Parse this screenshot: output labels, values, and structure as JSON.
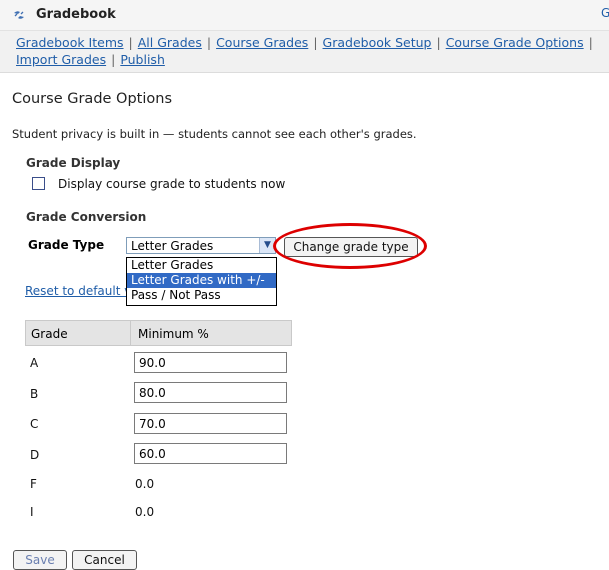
{
  "app": {
    "title": "Gradebook",
    "edge_glyph": "G"
  },
  "nav": {
    "row1": [
      "Gradebook Items",
      "All Grades",
      "Course Grades",
      "Gradebook Setup",
      "Course Grade Options"
    ],
    "row2": [
      "Import Grades",
      "Publish"
    ],
    "separator": "|"
  },
  "page": {
    "title": "Course Grade Options",
    "privacy_note": "Student privacy is built in — students cannot see each other's grades."
  },
  "grade_display": {
    "section_title": "Grade Display",
    "checkbox_label": "Display course grade to students now",
    "checked": false
  },
  "grade_conversion": {
    "section_title": "Grade Conversion",
    "grade_type_label": "Grade Type",
    "selected_value": "Letter Grades",
    "options": [
      "Letter Grades",
      "Letter Grades with +/-",
      "Pass / Not Pass"
    ],
    "highlighted_option_index": 1,
    "change_button_label": "Change grade type",
    "reset_link_label": "Reset to default v"
  },
  "table": {
    "headers": [
      "Grade",
      "Minimum %"
    ],
    "rows": [
      {
        "grade": "A",
        "min": "90.0",
        "editable": true
      },
      {
        "grade": "B",
        "min": "80.0",
        "editable": true
      },
      {
        "grade": "C",
        "min": "70.0",
        "editable": true
      },
      {
        "grade": "D",
        "min": "60.0",
        "editable": true
      },
      {
        "grade": "F",
        "min": "0.0",
        "editable": false
      },
      {
        "grade": "I",
        "min": "0.0",
        "editable": false
      }
    ]
  },
  "buttons": {
    "save": "Save",
    "cancel": "Cancel"
  },
  "colors": {
    "link": "#1f5da8",
    "highlight": "#316ac5",
    "annotation_red": "#dd0000",
    "header_bg": "#f5f5f5"
  },
  "icons": {
    "tool": "gradebook-tool-icon",
    "dropdown": "chevron-down-icon"
  }
}
